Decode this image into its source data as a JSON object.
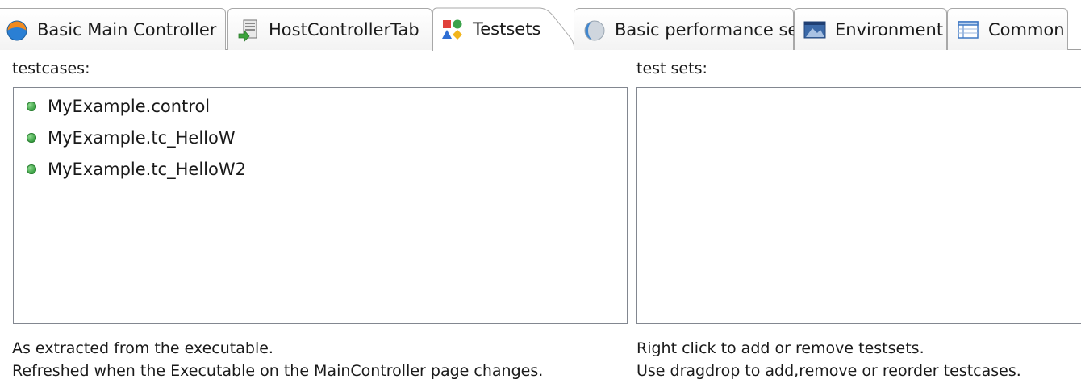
{
  "tabs": [
    {
      "label": "Basic Main Controller",
      "icon": "globe-icon"
    },
    {
      "label": "HostControllerTab",
      "icon": "host-controller-icon"
    },
    {
      "label": "Testsets",
      "icon": "testsets-shapes-icon",
      "active": true
    },
    {
      "label": "Basic performance set",
      "icon": "performance-icon"
    },
    {
      "label": "Environment",
      "icon": "environment-icon"
    },
    {
      "label": "Common",
      "icon": "common-table-icon"
    }
  ],
  "testcases": {
    "label": "testcases:",
    "items": [
      "MyExample.control",
      "MyExample.tc_HelloW",
      "MyExample.tc_HelloW2"
    ],
    "hint_line1": "As extracted from the executable.",
    "hint_line2": "Refreshed when the Executable on the MainController page changes."
  },
  "testsets": {
    "label": "test sets:",
    "items": [],
    "hint_line1": "Right click to add or remove testsets.",
    "hint_line2": "Use dragdrop to add,remove or reorder testcases."
  },
  "colors": {
    "item_dot": "#2f9a3a",
    "tab_border": "#a8a8a8",
    "list_border": "#828790"
  }
}
